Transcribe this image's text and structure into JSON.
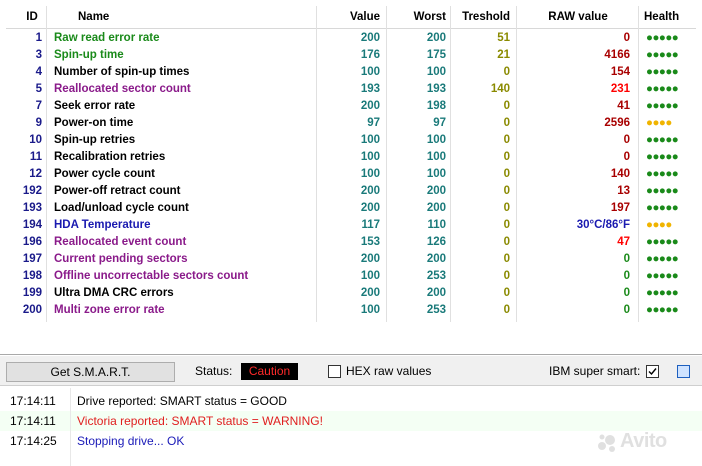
{
  "table": {
    "headers": {
      "id": "ID",
      "name": "Name",
      "value": "Value",
      "worst": "Worst",
      "threshold": "Treshold",
      "raw": "RAW value",
      "health": "Health"
    },
    "rows": [
      {
        "id": "1",
        "name": "Raw read error rate",
        "value": "200",
        "worst": "200",
        "threshold": "51",
        "raw": "0",
        "health": "●●●●●",
        "name_color": "#1a8a1a",
        "thr_color": "#8a8a00",
        "raw_color": "#a80000",
        "health_color": "#1a8a1a"
      },
      {
        "id": "3",
        "name": "Spin-up time",
        "value": "176",
        "worst": "175",
        "threshold": "21",
        "raw": "4166",
        "health": "●●●●●",
        "name_color": "#1a8a1a",
        "thr_color": "#8a8a00",
        "raw_color": "#a80000",
        "health_color": "#1a8a1a"
      },
      {
        "id": "4",
        "name": "Number of spin-up times",
        "value": "100",
        "worst": "100",
        "threshold": "0",
        "raw": "154",
        "health": "●●●●●",
        "name_color": "#000000",
        "thr_color": "#8a8a00",
        "raw_color": "#a80000",
        "health_color": "#1a8a1a"
      },
      {
        "id": "5",
        "name": "Reallocated sector count",
        "value": "193",
        "worst": "193",
        "threshold": "140",
        "raw": "231",
        "health": "●●●●●",
        "name_color": "#8a1a8a",
        "thr_color": "#8a8a00",
        "raw_color": "#ff0000",
        "health_color": "#1a8a1a"
      },
      {
        "id": "7",
        "name": "Seek error rate",
        "value": "200",
        "worst": "198",
        "threshold": "0",
        "raw": "41",
        "health": "●●●●●",
        "name_color": "#000000",
        "thr_color": "#8a8a00",
        "raw_color": "#a80000",
        "health_color": "#1a8a1a"
      },
      {
        "id": "9",
        "name": "Power-on time",
        "value": "97",
        "worst": "97",
        "threshold": "0",
        "raw": "2596",
        "health": "●●●●",
        "name_color": "#000000",
        "thr_color": "#8a8a00",
        "raw_color": "#a80000",
        "health_color": "#f0b400"
      },
      {
        "id": "10",
        "name": "Spin-up retries",
        "value": "100",
        "worst": "100",
        "threshold": "0",
        "raw": "0",
        "health": "●●●●●",
        "name_color": "#000000",
        "thr_color": "#8a8a00",
        "raw_color": "#a80000",
        "health_color": "#1a8a1a"
      },
      {
        "id": "11",
        "name": "Recalibration retries",
        "value": "100",
        "worst": "100",
        "threshold": "0",
        "raw": "0",
        "health": "●●●●●",
        "name_color": "#000000",
        "thr_color": "#8a8a00",
        "raw_color": "#a80000",
        "health_color": "#1a8a1a"
      },
      {
        "id": "12",
        "name": "Power cycle count",
        "value": "100",
        "worst": "100",
        "threshold": "0",
        "raw": "140",
        "health": "●●●●●",
        "name_color": "#000000",
        "thr_color": "#8a8a00",
        "raw_color": "#a80000",
        "health_color": "#1a8a1a"
      },
      {
        "id": "192",
        "name": "Power-off retract count",
        "value": "200",
        "worst": "200",
        "threshold": "0",
        "raw": "13",
        "health": "●●●●●",
        "name_color": "#000000",
        "thr_color": "#8a8a00",
        "raw_color": "#a80000",
        "health_color": "#1a8a1a"
      },
      {
        "id": "193",
        "name": "Load/unload cycle count",
        "value": "200",
        "worst": "200",
        "threshold": "0",
        "raw": "197",
        "health": "●●●●●",
        "name_color": "#000000",
        "thr_color": "#8a8a00",
        "raw_color": "#a80000",
        "health_color": "#1a8a1a"
      },
      {
        "id": "194",
        "name": "HDA Temperature",
        "value": "117",
        "worst": "110",
        "threshold": "0",
        "raw": "30°C/86°F",
        "health": "●●●●",
        "name_color": "#1a1ab0",
        "thr_color": "#8a8a00",
        "raw_color": "#1a1ab0",
        "health_color": "#f0b400"
      },
      {
        "id": "196",
        "name": "Reallocated event count",
        "value": "153",
        "worst": "126",
        "threshold": "0",
        "raw": "47",
        "health": "●●●●●",
        "name_color": "#8a1a8a",
        "thr_color": "#8a8a00",
        "raw_color": "#ff0000",
        "health_color": "#1a8a1a"
      },
      {
        "id": "197",
        "name": "Current pending sectors",
        "value": "200",
        "worst": "200",
        "threshold": "0",
        "raw": "0",
        "health": "●●●●●",
        "name_color": "#8a1a8a",
        "thr_color": "#8a8a00",
        "raw_color": "#1a8a1a",
        "health_color": "#1a8a1a"
      },
      {
        "id": "198",
        "name": "Offline uncorrectable sectors count",
        "value": "100",
        "worst": "253",
        "threshold": "0",
        "raw": "0",
        "health": "●●●●●",
        "name_color": "#8a1a8a",
        "thr_color": "#8a8a00",
        "raw_color": "#1a8a1a",
        "health_color": "#1a8a1a"
      },
      {
        "id": "199",
        "name": "Ultra DMA CRC errors",
        "value": "200",
        "worst": "200",
        "threshold": "0",
        "raw": "0",
        "health": "●●●●●",
        "name_color": "#000000",
        "thr_color": "#8a8a00",
        "raw_color": "#1a8a1a",
        "health_color": "#1a8a1a"
      },
      {
        "id": "200",
        "name": "Multi zone error rate",
        "value": "100",
        "worst": "253",
        "threshold": "0",
        "raw": "0",
        "health": "●●●●●",
        "name_color": "#8a1a8a",
        "thr_color": "#8a8a00",
        "raw_color": "#1a8a1a",
        "health_color": "#1a8a1a"
      }
    ],
    "id_color": "#1a1a8a",
    "value_color": "#1a7a7a"
  },
  "toolbar": {
    "get_smart_label": "Get S.M.A.R.T.",
    "status_label": "Status:",
    "status_value": "Caution",
    "hex_label": "HEX raw values",
    "hex_checked": false,
    "ibm_label": "IBM super smart:",
    "ibm_checked": true
  },
  "log": [
    {
      "time": "17:14:11",
      "message": "Drive reported: SMART status = GOOD",
      "color": "#000000",
      "bg": "#ffffff"
    },
    {
      "time": "17:14:11",
      "message": "Victoria reported: SMART status = WARNING!",
      "color": "#e02020",
      "bg": "#f4fff4"
    },
    {
      "time": "17:14:25",
      "message": "Stopping drive... OK",
      "color": "#1a1ab8",
      "bg": "#ffffff"
    }
  ],
  "watermark": {
    "text": "Avito",
    "icon": "avito-logo-icon"
  }
}
